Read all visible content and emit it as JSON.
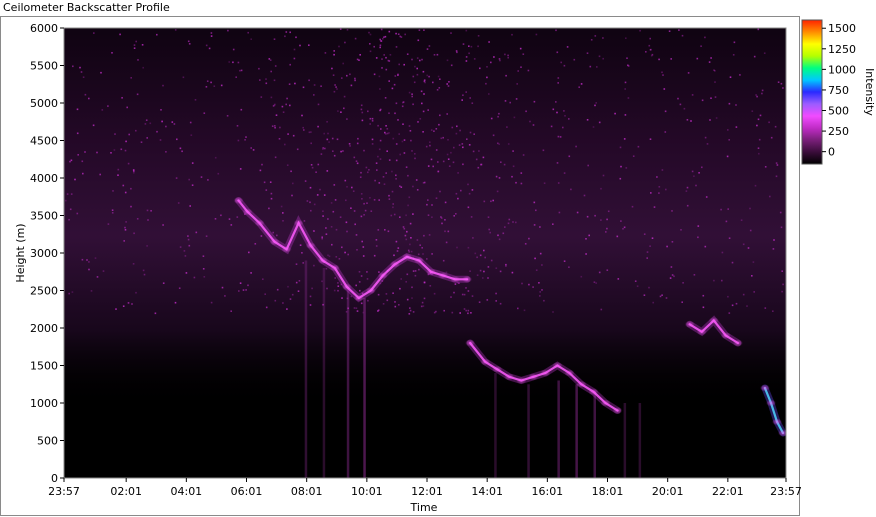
{
  "window": {
    "title": "Ceilometer Backscatter Profile"
  },
  "chart_data": {
    "type": "heatmap",
    "title": "Ceilometer Backscatter Profile",
    "xlabel": "Time",
    "ylabel": "Height (m)",
    "x_tick_labels": [
      "23:57",
      "02:01",
      "04:01",
      "06:01",
      "08:01",
      "10:01",
      "12:01",
      "14:01",
      "16:01",
      "18:01",
      "20:01",
      "22:01",
      "23:57"
    ],
    "x_tick_hours": [
      0,
      2.067,
      4.067,
      6.067,
      8.067,
      10.067,
      12.067,
      14.067,
      16.067,
      18.067,
      20.067,
      22.067,
      24
    ],
    "x_range_hours": [
      0,
      24
    ],
    "y_ticks": [
      0,
      500,
      1000,
      1500,
      2000,
      2500,
      3000,
      3500,
      4000,
      4500,
      5000,
      5500,
      6000
    ],
    "ylim": [
      0,
      6000
    ],
    "colorbar": {
      "label": "Intensity",
      "ticks": [
        0,
        250,
        500,
        750,
        1000,
        1250,
        1500
      ],
      "range": [
        -150,
        1600
      ],
      "colors": [
        "#000000",
        "#3a0d3a",
        "#7a1f7a",
        "#c02cc6",
        "#f14bff",
        "#9b5cff",
        "#2a2aff",
        "#00c8ff",
        "#00ff80",
        "#b4ff00",
        "#ffff00",
        "#ff8c00",
        "#ff2200"
      ]
    },
    "layers": [
      {
        "name": "cloud-layer",
        "points": [
          [
            5.8,
            3700
          ],
          [
            6.1,
            3550
          ],
          [
            6.5,
            3400
          ],
          [
            7.0,
            3150
          ],
          [
            7.4,
            3050
          ],
          [
            7.8,
            3400
          ],
          [
            8.2,
            3100
          ],
          [
            8.6,
            2900
          ],
          [
            9.0,
            2800
          ],
          [
            9.4,
            2550
          ],
          [
            9.8,
            2400
          ],
          [
            10.2,
            2500
          ],
          [
            10.6,
            2700
          ],
          [
            11.0,
            2850
          ],
          [
            11.4,
            2950
          ],
          [
            11.8,
            2900
          ],
          [
            12.2,
            2750
          ],
          [
            12.6,
            2700
          ],
          [
            13.0,
            2650
          ],
          [
            13.4,
            2650
          ]
        ]
      },
      {
        "name": "lower-layer",
        "points": [
          [
            13.5,
            1800
          ],
          [
            14.0,
            1550
          ],
          [
            14.4,
            1450
          ],
          [
            14.8,
            1350
          ],
          [
            15.2,
            1300
          ],
          [
            15.6,
            1350
          ],
          [
            16.0,
            1400
          ],
          [
            16.4,
            1500
          ],
          [
            16.8,
            1400
          ],
          [
            17.2,
            1250
          ],
          [
            17.6,
            1150
          ],
          [
            18.0,
            1000
          ],
          [
            18.4,
            900
          ]
        ]
      },
      {
        "name": "evening-layer",
        "points": [
          [
            20.8,
            2050
          ],
          [
            21.2,
            1950
          ],
          [
            21.6,
            2100
          ],
          [
            22.0,
            1900
          ],
          [
            22.4,
            1800
          ]
        ]
      },
      {
        "name": "surface-return",
        "points": [
          [
            23.3,
            1200
          ],
          [
            23.5,
            1000
          ],
          [
            23.7,
            750
          ],
          [
            23.9,
            600
          ]
        ]
      }
    ]
  }
}
